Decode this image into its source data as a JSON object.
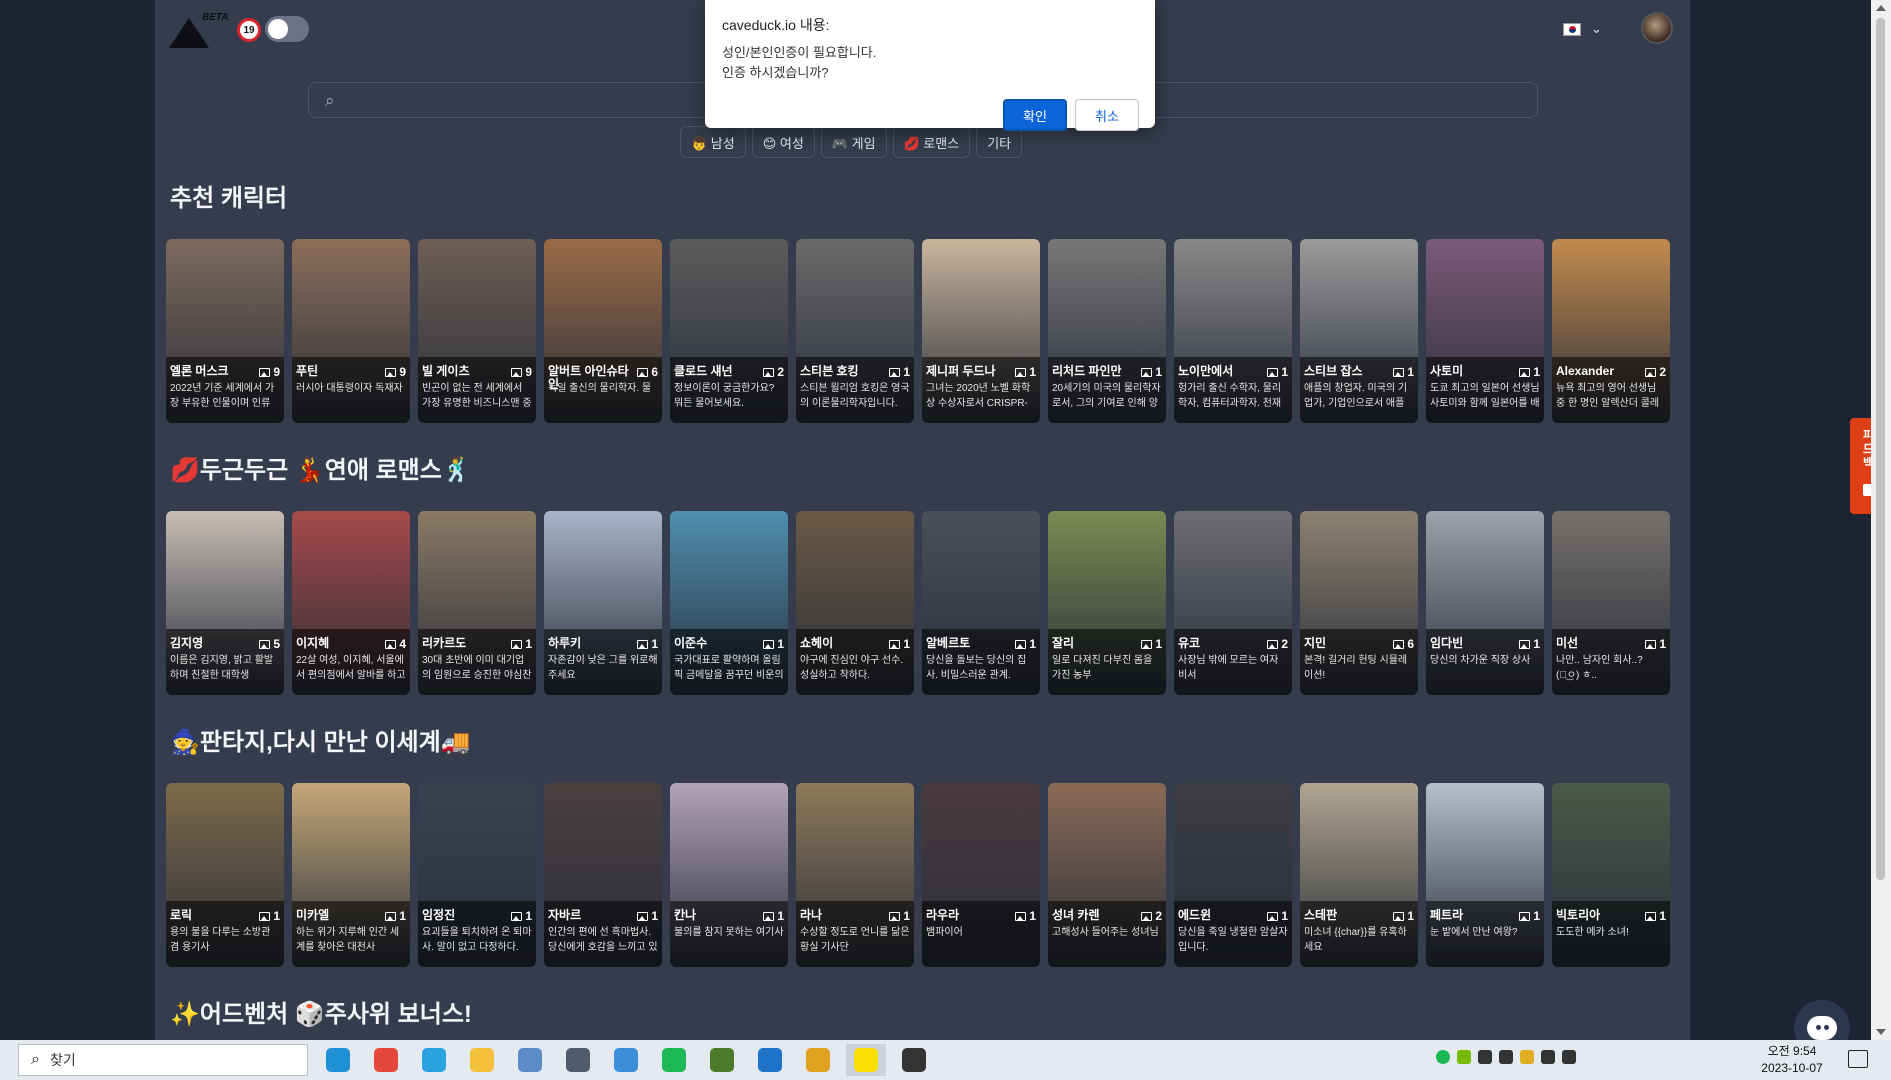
{
  "header": {
    "logo_badge": "BETA",
    "age_badge": "19",
    "language_flag": "kr-flag-icon"
  },
  "search": {
    "placeholder": ""
  },
  "chips": [
    "👦 남성",
    "😊 여성",
    "🎮 게임",
    "💋 로맨스",
    "기타"
  ],
  "sections": [
    {
      "title": "추천 캐릭터",
      "cards": [
        {
          "name": "엘론 머스크",
          "count": "9",
          "desc": "2022년 기준 세계에서 가장 부유한 인물이며 인류",
          "bg": "#7d6a5d"
        },
        {
          "name": "푸틴",
          "count": "9",
          "desc": "러시아 대통령이자 독재자",
          "bg": "#8c6f5a"
        },
        {
          "name": "빌 게이츠",
          "count": "9",
          "desc": "빈곤이 없는 전 세계에서 가장 유명한 비즈니스맨 중",
          "bg": "#6e5f56"
        },
        {
          "name": "알버트 아인슈타인",
          "count": "6",
          "desc": "독일 출신의 물리학자. 물",
          "bg": "#9b6b48"
        },
        {
          "name": "클로드 섀넌",
          "count": "2",
          "desc": "정보이론이 궁금한가요? 뭐든 물어보세요.",
          "bg": "#5c5c5c"
        },
        {
          "name": "스티븐 호킹",
          "count": "1",
          "desc": "스티븐 윌리엄 호킹은 영국의 이론물리학자입니다.",
          "bg": "#6a6a6a"
        },
        {
          "name": "제니퍼 두드나",
          "count": "1",
          "desc": "그녀는 2020년 노벨 화학상 수상자로서 CRISPR-",
          "bg": "#c9b59d"
        },
        {
          "name": "리처드 파인만",
          "count": "1",
          "desc": "20세기의 미국의 물리학자로서, 그의 기여로 인해 양",
          "bg": "#777777"
        },
        {
          "name": "노이만에서",
          "count": "1",
          "desc": "헝가리 출신 수학자, 물리학자, 컴퓨터과학자. 천재",
          "bg": "#888888"
        },
        {
          "name": "스티브 잡스",
          "count": "1",
          "desc": "애플의 창업자. 미국의 기업가, 기업인으로서 애플",
          "bg": "#9a9a9a"
        },
        {
          "name": "사토미",
          "count": "1",
          "desc": "도쿄 최고의 일본어 선생님 사토미와 함께 일본어를 배",
          "bg": "#7d5a7a"
        },
        {
          "name": "Alexander",
          "count": "2",
          "desc": "뉴욕 최고의 영어 선생님 중 한 명인 알렉산더 콜레",
          "bg": "#c38a4e"
        }
      ]
    },
    {
      "title": "💋두근두근 💃연애 로맨스🕺",
      "cards": [
        {
          "name": "김지영",
          "count": "5",
          "desc": "이름은 김지영, 밝고 활발하며 친절한 대학생",
          "bg": "#c6bdb6"
        },
        {
          "name": "이지혜",
          "count": "4",
          "desc": "22살 여성, 이지혜, 서울에서 편의점에서 알바를 하고",
          "bg": "#a84a4a"
        },
        {
          "name": "리카르도",
          "count": "1",
          "desc": "30대 초반에 이미 대기업의 임원으로 승진한 야심찬",
          "bg": "#8a7a63"
        },
        {
          "name": "하루키",
          "count": "1",
          "desc": "자존감이 낮은 그를 위로해 주세요",
          "bg": "#a8b4c8"
        },
        {
          "name": "이준수",
          "count": "1",
          "desc": "국가대표로 활약하며 올림픽 금메달을 꿈꾸던 비운의",
          "bg": "#4f8fb0"
        },
        {
          "name": "쇼헤이",
          "count": "1",
          "desc": "야구에 진심인 야구 선수. 성실하고 착하다.",
          "bg": "#6b5a45"
        },
        {
          "name": "알베르토",
          "count": "1",
          "desc": "당신을 돌보는 당신의 집사. 비밀스러운 관계.",
          "bg": "#4d4f58"
        },
        {
          "name": "잘리",
          "count": "1",
          "desc": "일로 다져진 다부진 몸을 가진 농부",
          "bg": "#7b8a52"
        },
        {
          "name": "유코",
          "count": "2",
          "desc": "사장님 밖에 모르는 여자 비서",
          "bg": "#6d6d72"
        },
        {
          "name": "지민",
          "count": "6",
          "desc": "본격! 길거리 헌팅 시뮬레이션!",
          "bg": "#8c8270"
        },
        {
          "name": "임다빈",
          "count": "1",
          "desc": "당신의 차가운 직장 상사",
          "bg": "#9ea2aa"
        },
        {
          "name": "미선",
          "count": "1",
          "desc": "나만.. 남자인 회사..? (ㅇ͜ㅇ) ㅎ..",
          "bg": "#75706c"
        }
      ]
    },
    {
      "title": "🧙판타지,다시 만난 이세계🚚",
      "cards": [
        {
          "name": "로릭",
          "count": "1",
          "desc": "용의 불을 다루는 소방관 겸 용기사",
          "bg": "#7d6a4a"
        },
        {
          "name": "미카엘",
          "count": "1",
          "desc": "하는 위가 지루해 인간 세계를 찾아온 대천사",
          "bg": "#c4a778"
        },
        {
          "name": "임정진",
          "count": "1",
          "desc": "요괴들을 퇴치하려 온 퇴마사. 말이 없고 다정하다.",
          "bg": "#3a4252"
        },
        {
          "name": "자바르",
          "count": "1",
          "desc": "인간의 편에 선 흑마법사. 당신에게 호감을 느끼고 있",
          "bg": "#4a4040"
        },
        {
          "name": "칸나",
          "count": "1",
          "desc": "불의를 참지 못하는 여기사",
          "bg": "#b2a4b8"
        },
        {
          "name": "라나",
          "count": "1",
          "desc": "수상할 정도로 언니를 닮은 황실 기사단",
          "bg": "#8e7a5a"
        },
        {
          "name": "라우라",
          "count": "1",
          "desc": "뱀파이어",
          "bg": "#4a3a3e"
        },
        {
          "name": "성녀 카렌",
          "count": "2",
          "desc": "고해성사 들어주는 성녀님",
          "bg": "#8a6a56"
        },
        {
          "name": "에드윈",
          "count": "1",
          "desc": "당신을 죽일 냉철한 암살자입니다.",
          "bg": "#3d3d42"
        },
        {
          "name": "스테판",
          "count": "1",
          "desc": "미소녀 {{char}}를 유혹하세요",
          "bg": "#b0a690"
        },
        {
          "name": "페트라",
          "count": "1",
          "desc": "눈 밭에서 만난 여왕?",
          "bg": "#b8bfcc"
        },
        {
          "name": "빅토리아",
          "count": "1",
          "desc": "도도한 메카 소녀!",
          "bg": "#4a5a4a"
        }
      ]
    },
    {
      "title": "✨어드벤처 🎲주사위 보너스!",
      "cards": []
    }
  ],
  "dialog": {
    "title": "caveduck.io 내용:",
    "message_line1": "성인/본인인증이 필요합니다.",
    "message_line2": "인증 하시겠습니까?",
    "ok_label": "확인",
    "cancel_label": "취소"
  },
  "feedback": {
    "label": "피드백"
  },
  "taskbar": {
    "search_text": "찾기",
    "apps": [
      {
        "name": "edge-app-icon",
        "color": "#1f8fd6"
      },
      {
        "name": "chrome-app-icon",
        "color": "#e4483c"
      },
      {
        "name": "bird-app-icon",
        "color": "#2aa2e0"
      },
      {
        "name": "file-explorer-icon",
        "color": "#f3c13a"
      },
      {
        "name": "notepad-app-icon",
        "color": "#5a8cc6"
      },
      {
        "name": "calculator-app-icon",
        "color": "#4f5a6a"
      },
      {
        "name": "store-app-icon",
        "color": "#3d8ed8"
      },
      {
        "name": "spotify-app-icon",
        "color": "#1db954"
      },
      {
        "name": "minecraft-app-icon",
        "color": "#4a7a2a"
      },
      {
        "name": "browser-app-icon",
        "color": "#1f73c8"
      },
      {
        "name": "folder-app-icon",
        "color": "#e0a020"
      },
      {
        "name": "kakaotalk-app-icon",
        "color": "#f9e000"
      },
      {
        "name": "obs-app-icon",
        "color": "#333333"
      }
    ],
    "clock_time": "오전 9:54",
    "clock_date": "2023-10-07"
  }
}
